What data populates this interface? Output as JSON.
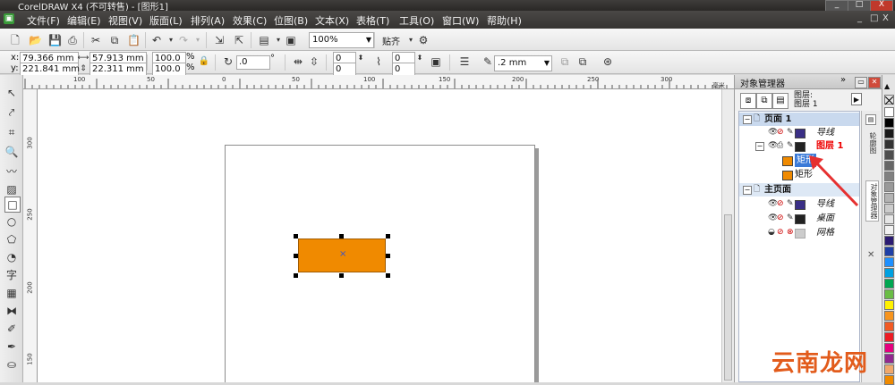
{
  "window": {
    "title": "CorelDRAW X4 (不可转售) - [图形1]",
    "controls": [
      "_",
      "□",
      "X"
    ],
    "mdi_controls": [
      "_",
      "□",
      "X"
    ]
  },
  "menu": {
    "items": [
      "文件(F)",
      "编辑(E)",
      "视图(V)",
      "版面(L)",
      "排列(A)",
      "效果(C)",
      "位图(B)",
      "文本(X)",
      "表格(T)",
      "工具(O)",
      "窗口(W)",
      "帮助(H)"
    ]
  },
  "toolbar": {
    "zoom_value": "100%",
    "snap_label": "贴齐"
  },
  "property_bar": {
    "x_label": "x:",
    "x_value": "79.366 mm",
    "y_label": "y:",
    "y_value": "221.841 mm",
    "width_value": "57.913 mm",
    "height_value": "22.311 mm",
    "scale_w": "100.0",
    "scale_h": "100.0",
    "percent": "%",
    "rotation": ".0",
    "degree": "°",
    "corner_tl": "0",
    "corner_bl": "0",
    "corner_tr": "0",
    "corner_br": "0",
    "outline_width": ".2 mm"
  },
  "ruler_top": {
    "ticks": [
      "100",
      "50",
      "0",
      "50",
      "100",
      "150",
      "200",
      "250",
      "300"
    ],
    "unit": "毫米"
  },
  "ruler_left": {
    "ticks": [
      "300",
      "250",
      "200",
      "150"
    ]
  },
  "colors": {
    "shape_fill": "#f08a00",
    "handle": "#000000",
    "accent_blue": "#3a53c7",
    "watermark": "#e25b1b"
  },
  "docker": {
    "title": "对象管理器",
    "layer_label_1": "图层:",
    "layer_label_2": "图层 1",
    "tree": [
      {
        "label": "页面 1",
        "type": "page"
      },
      {
        "label": "导线",
        "type": "layer",
        "swatch": "#3a2f86"
      },
      {
        "label": "图层 1",
        "type": "layer-active",
        "swatch": "#222222"
      },
      {
        "label": "矩形",
        "type": "object-selected",
        "swatch": "#f08a00"
      },
      {
        "label": "矩形",
        "type": "object",
        "swatch": "#f08a00"
      },
      {
        "label": "主页面",
        "type": "page"
      },
      {
        "label": "导线",
        "type": "layer",
        "swatch": "#3a2f86"
      },
      {
        "label": "桌面",
        "type": "layer",
        "swatch": "#222222"
      },
      {
        "label": "网格",
        "type": "layer",
        "swatch": "#cccccc"
      }
    ],
    "side_tabs": [
      "轮廓图",
      "对象管理器"
    ]
  },
  "palette": [
    "#ffffff",
    "#000000",
    "#1a1a1a",
    "#333333",
    "#4d4d4d",
    "#666666",
    "#808080",
    "#999999",
    "#b3b3b3",
    "#cccccc",
    "#e6e6e6",
    "#f2f2f2",
    "#2b1b72",
    "#1e3fa6",
    "#1e90ff",
    "#00a0e0",
    "#00a651",
    "#6abd45",
    "#fff200",
    "#f7941d",
    "#f15a24",
    "#ed1c24",
    "#e5007e",
    "#92278f",
    "#f0a86c",
    "#f08a00"
  ],
  "watermark": "云南龙网"
}
